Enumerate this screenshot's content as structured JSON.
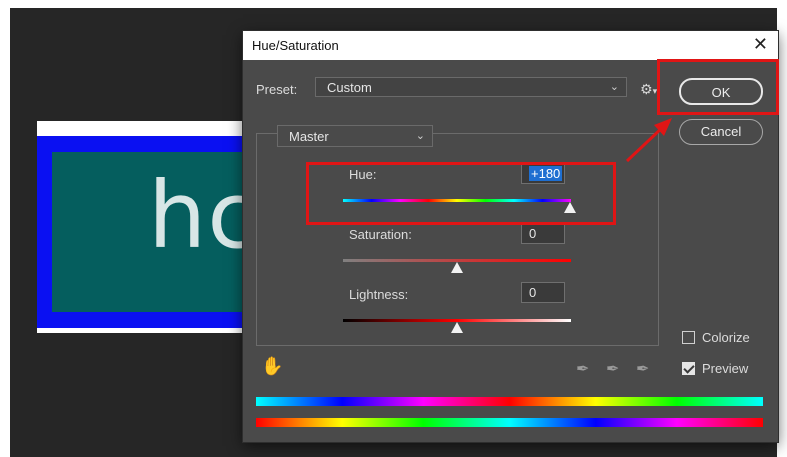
{
  "document": {
    "text": "hc"
  },
  "dialog": {
    "title": "Hue/Saturation",
    "close_glyph": "✕",
    "preset_label": "Preset:",
    "preset_value": "Custom",
    "gear_icon": "gear-icon",
    "channel_value": "Master",
    "ok_label": "OK",
    "cancel_label": "Cancel",
    "hue": {
      "label": "Hue:",
      "value": "+180"
    },
    "saturation": {
      "label": "Saturation:",
      "value": "0"
    },
    "lightness": {
      "label": "Lightness:",
      "value": "0"
    },
    "colorize_label": "Colorize",
    "preview_label": "Preview",
    "colorize_checked": false,
    "preview_checked": true
  },
  "annotation": {
    "color": "#e01515"
  }
}
